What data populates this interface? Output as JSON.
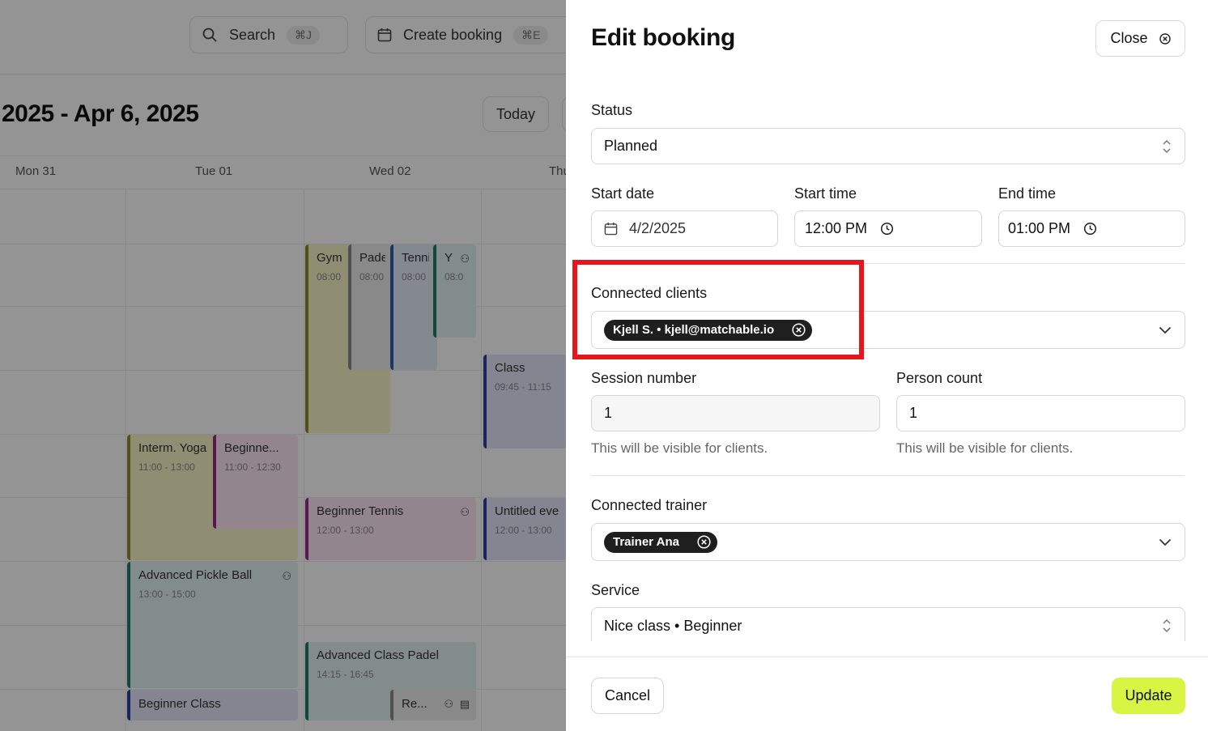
{
  "background": {
    "search_label": "Search",
    "search_shortcut": "⌘J",
    "create_label": "Create booking",
    "create_shortcut": "⌘E",
    "date_range": "2025 - Apr 6, 2025",
    "today_label": "Today",
    "days": [
      "Mon 31",
      "Tue 01",
      "Wed 02",
      "Thu"
    ],
    "events": [
      {
        "title": "Gym",
        "time": "08:00"
      },
      {
        "title": "Pade",
        "time": "08:00"
      },
      {
        "title": "Tenni",
        "time": "08:00"
      },
      {
        "title": "Y",
        "time": "08:0"
      },
      {
        "title": "Class",
        "time": "09:45 - 11:15"
      },
      {
        "title": "Interm. Yoga",
        "time": "11:00 - 13:00"
      },
      {
        "title": "Beginne...",
        "time": "11:00 - 12:30"
      },
      {
        "title": "Beginner Tennis",
        "time": "12:00 - 13:00"
      },
      {
        "title": "Untitled eve",
        "time": "12:00 - 13:00"
      },
      {
        "title": "Advanced Pickle Ball",
        "time": "13:00 - 15:00"
      },
      {
        "title": "Advanced Class Padel",
        "time": "14:15 - 16:45"
      },
      {
        "title": "Beginner Class",
        "time": ""
      },
      {
        "title": "Re...",
        "time": ""
      }
    ]
  },
  "panel": {
    "title": "Edit booking",
    "close_label": "Close",
    "status": {
      "label": "Status",
      "value": "Planned"
    },
    "start_date": {
      "label": "Start date",
      "value": "4/2/2025"
    },
    "start_time": {
      "label": "Start time",
      "value": "12:00 PM"
    },
    "end_time": {
      "label": "End time",
      "value": "01:00 PM"
    },
    "connected_clients": {
      "label": "Connected clients",
      "chips": [
        "Kjell S. • kjell@matchable.io"
      ]
    },
    "session_number": {
      "label": "Session number",
      "value": "1",
      "hint": "This will be visible for clients."
    },
    "person_count": {
      "label": "Person count",
      "value": "1",
      "hint": "This will be visible for clients."
    },
    "connected_trainer": {
      "label": "Connected trainer",
      "chips": [
        "Trainer Ana"
      ]
    },
    "service": {
      "label": "Service",
      "value": "Nice class • Beginner"
    },
    "cancel_label": "Cancel",
    "update_label": "Update",
    "accent_color": "#d7f542",
    "highlight_color": "#e5161d"
  }
}
